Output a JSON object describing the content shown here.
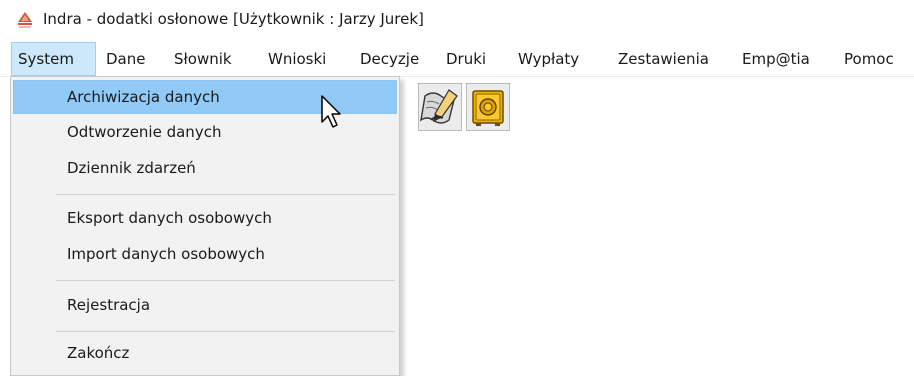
{
  "window": {
    "title": "Indra - dodatki osłonowe  [Użytkownik : Jarzy Jurek]",
    "icon": "app-logo-icon"
  },
  "menubar": {
    "items": [
      {
        "label": "System",
        "active": true
      },
      {
        "label": "Dane"
      },
      {
        "label": "Słownik"
      },
      {
        "label": "Wnioski"
      },
      {
        "label": "Decyzje"
      },
      {
        "label": "Druki"
      },
      {
        "label": "Wypłaty"
      },
      {
        "label": "Zestawienia"
      },
      {
        "label": "Emp@tia"
      },
      {
        "label": "Pomoc"
      }
    ]
  },
  "toolbar": {
    "buttons": [
      {
        "icon": "sign-document-icon"
      },
      {
        "icon": "safe-icon"
      }
    ]
  },
  "system_menu": {
    "items": [
      {
        "label": "Archiwizacja danych",
        "highlighted": true
      },
      {
        "label": "Odtworzenie danych"
      },
      {
        "label": "Dziennik zdarzeń"
      },
      {
        "label": "Eksport danych osobowych"
      },
      {
        "label": "Import danych osobowych"
      },
      {
        "label": "Rejestracja"
      },
      {
        "label": "Zakończ"
      }
    ]
  },
  "colors": {
    "menu_active_bg": "#cde8fb",
    "menu_highlight_bg": "#91c9f7",
    "dropdown_bg": "#f2f2f2",
    "safe_gold": "#f0b400"
  }
}
